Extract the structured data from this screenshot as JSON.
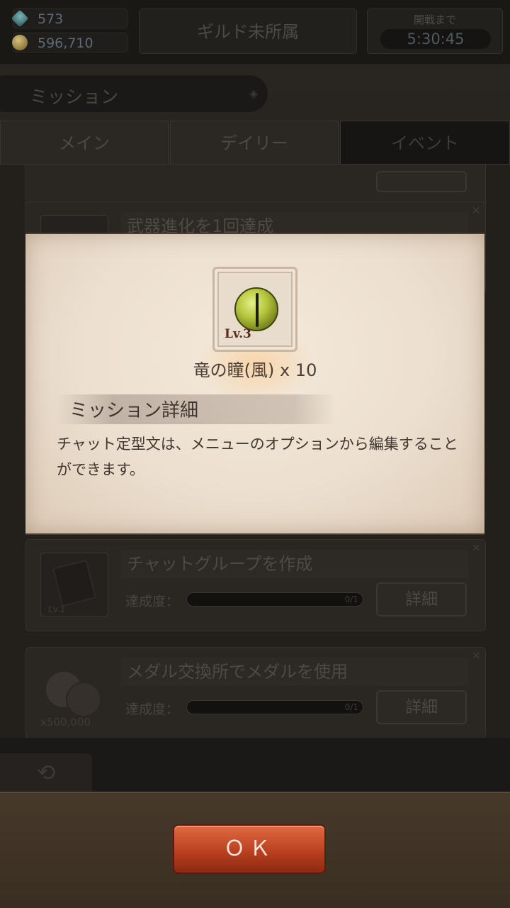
{
  "resources": {
    "gems": "573",
    "coins": "596,710"
  },
  "guild": {
    "status": "ギルド未所属"
  },
  "timer": {
    "label": "開戦まで",
    "value": "5:30:45"
  },
  "mission_header": {
    "title": "ミッション"
  },
  "tabs": [
    {
      "label": "メイン"
    },
    {
      "label": "デイリー"
    },
    {
      "label": "イベント"
    }
  ],
  "cards": [
    {
      "title": "武器進化を1回達成"
    },
    {
      "title": "チャットグループを作成",
      "thumb_caption": "Lv.1",
      "progress_label": "達成度：",
      "progress": "0/1",
      "detail": "詳細"
    },
    {
      "title": "メダル交換所でメダルを使用",
      "thumb_caption": "x500,000",
      "progress_label": "達成度：",
      "progress": "0/1",
      "detail": "詳細"
    }
  ],
  "modal": {
    "item_level": "Lv.3",
    "item_name": "竜の瞳(風) x 10",
    "section_title": "ミッション詳細",
    "description": "チャット定型文は、メニューのオプションから編集することができます。"
  },
  "footer": {
    "ok_label": "ＯＫ"
  },
  "colors": {
    "ok_button": "#c24a24",
    "modal_paper": "#efe3d4"
  },
  "icons": {
    "gem": "gem-icon",
    "coin": "coin-icon",
    "item": "dragon-eye-icon",
    "back": "back-arrow-icon"
  }
}
